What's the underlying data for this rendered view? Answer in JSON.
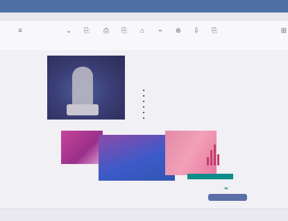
{
  "window": {
    "title": "",
    "menu": ""
  },
  "toolbar": {
    "buttons": [
      "≡",
      "⌄",
      "⎘",
      "⎙",
      "⎘",
      "⌂",
      "⌁",
      "⊕",
      "⇩",
      "⎘",
      "⊞"
    ],
    "right_label": "",
    "subtext": ""
  },
  "article": {
    "headline": "",
    "blurb": "",
    "bullets": [
      "",
      "",
      "",
      "",
      "",
      ""
    ]
  },
  "footer_link": "",
  "pill_button": "",
  "statusbar": {
    "left": "",
    "center": "",
    "center2": "",
    "right": ""
  },
  "colors": {
    "titlebar": "#4d6fa4",
    "accent": "#c23d6a",
    "teal": "#0f8d8a"
  }
}
